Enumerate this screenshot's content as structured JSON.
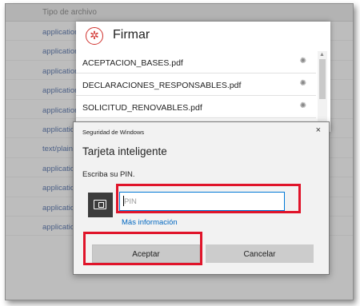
{
  "background": {
    "column_header": "Tipo de archivo",
    "rows": [
      "application",
      "application",
      "application",
      "application",
      "application",
      "application",
      "text/plain",
      "application",
      "application",
      "application",
      "application"
    ]
  },
  "firmar": {
    "title": "Firmar",
    "icon": "gear-icon",
    "files": [
      {
        "name": "ACEPTACION_BASES.pdf",
        "status_icon": "spinner-icon"
      },
      {
        "name": "DECLARACIONES_RESPONSABLES.pdf",
        "status_icon": "spinner-icon"
      },
      {
        "name": "SOLICITUD_RENOVABLES.pdf",
        "status_icon": "spinner-icon"
      }
    ]
  },
  "security_dialog": {
    "caption": "Seguridad de Windows",
    "title": "Tarjeta inteligente",
    "prompt": "Escriba su PIN.",
    "pin_placeholder": "PIN",
    "pin_value": "",
    "more_info": "Más información",
    "ok_label": "Aceptar",
    "cancel_label": "Cancelar",
    "close_glyph": "×"
  },
  "highlight_color": "#e0142a"
}
